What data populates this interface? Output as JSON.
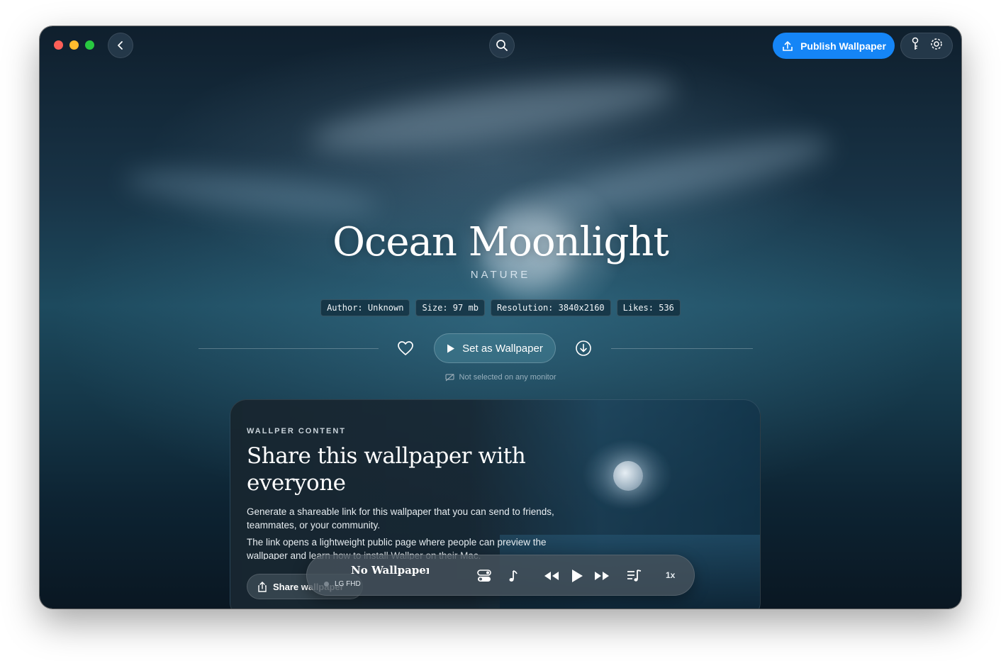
{
  "toolbar": {
    "publish_label": "Publish Wallpaper"
  },
  "wallpaper": {
    "title": "Ocean Moonlight",
    "category": "NATURE",
    "meta": [
      "Author: Unknown",
      "Size: 97 mb",
      "Resolution: 3840x2160",
      "Likes: 536"
    ],
    "set_label": "Set as Wallpaper",
    "monitor_status": "Not selected on any monitor"
  },
  "card": {
    "eyebrow": "WALLPER CONTENT",
    "title": "Share this wallpaper with everyone",
    "paragraph1": "Generate a shareable link for this wallpaper that you can send to friends, teammates, or your community.",
    "paragraph2": "The link opens a lightweight public page where people can preview the wallpaper and learn how to install Wallper on their Mac.",
    "share_label": "Share wallpaper"
  },
  "player": {
    "title": "No Wallpaper I",
    "monitor": "LG FHD",
    "speed": "1x"
  },
  "colors": {
    "accent": "#1585f6",
    "close": "#fe5f57",
    "minimize": "#febc2e",
    "zoom": "#28c840"
  }
}
